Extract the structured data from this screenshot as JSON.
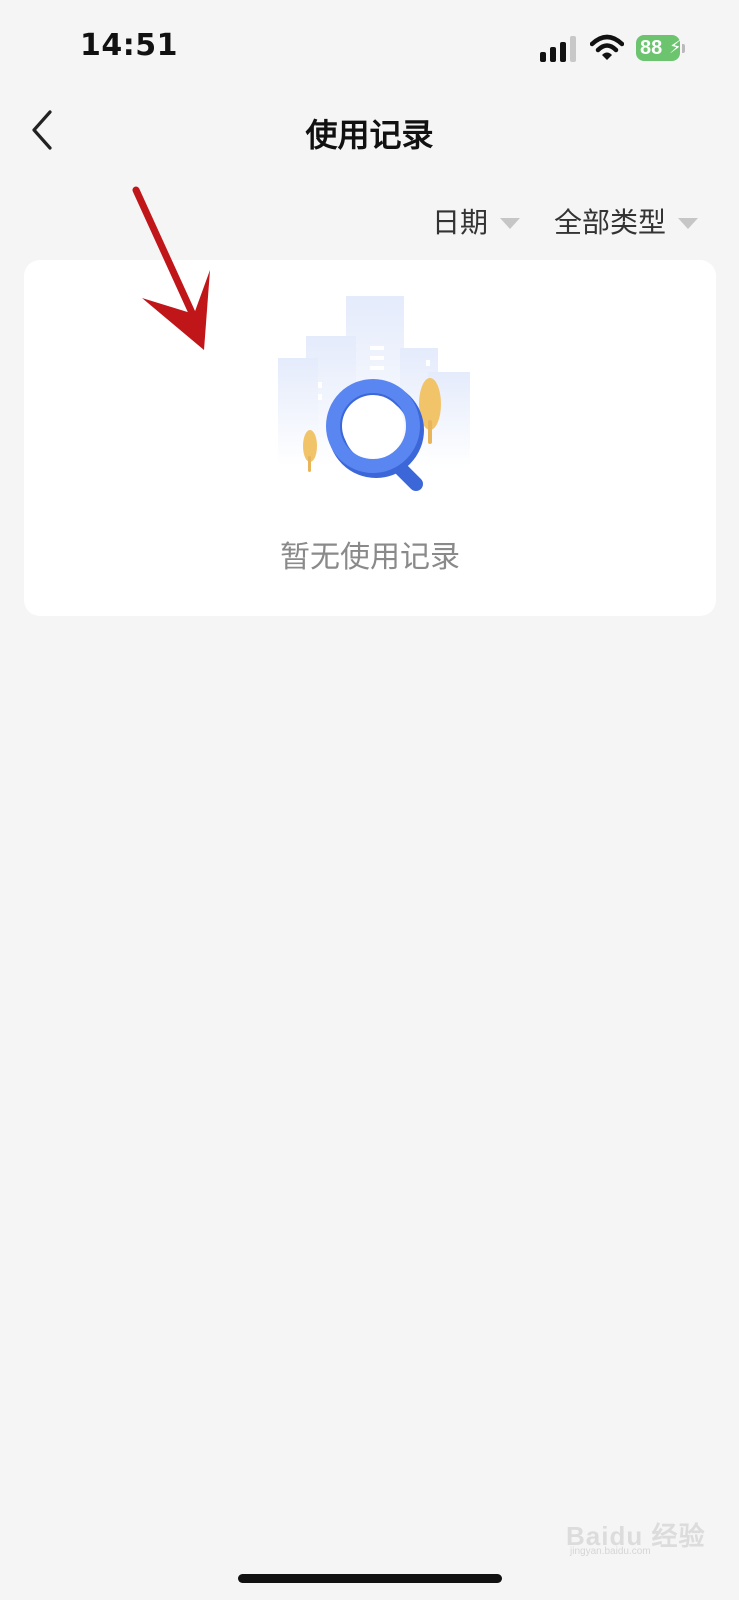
{
  "status_bar": {
    "time": "14:51",
    "battery_level": "88",
    "signal_icon": "cellular-signal-icon",
    "wifi_icon": "wifi-icon",
    "battery_icon": "battery-charging-icon"
  },
  "nav": {
    "title": "使用记录",
    "back_icon": "chevron-left-icon"
  },
  "filters": {
    "date_label": "日期",
    "type_label": "全部类型",
    "caret_icon": "caret-down-icon"
  },
  "empty_state": {
    "illustration_icon": "magnifier-search-icon",
    "message": "暂无使用记录"
  },
  "watermark": {
    "text": "Baidu 经验",
    "sub": "jingyan.baidu.com"
  },
  "colors": {
    "background": "#f5f5f5",
    "card": "#ffffff",
    "accent_blue": "#4f7cf0",
    "tree_yellow": "#f2c46a",
    "annotation_red": "#c0161a",
    "battery_green": "#6cc46f"
  }
}
